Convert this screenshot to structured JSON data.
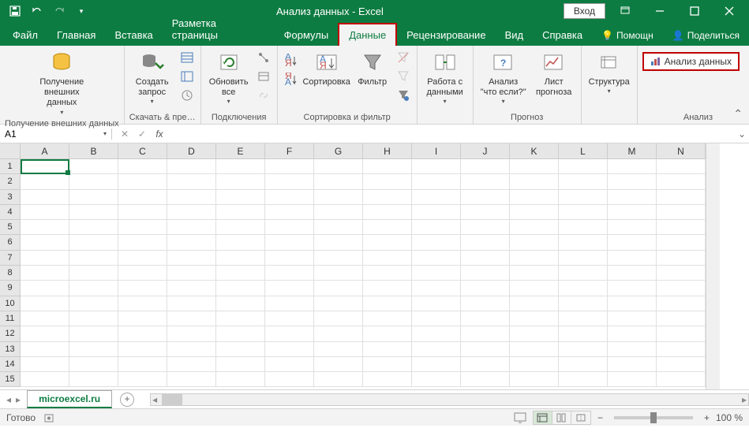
{
  "title": "Анализ данных  -  Excel",
  "login": "Вход",
  "tabs": [
    "Файл",
    "Главная",
    "Вставка",
    "Разметка страницы",
    "Формулы",
    "Данные",
    "Рецензирование",
    "Вид",
    "Справка"
  ],
  "active_tab": "Данные",
  "right_tabs": {
    "help": "Помощн",
    "share": "Поделиться"
  },
  "ribbon": {
    "ext_data": {
      "label": "Получение внешних данных",
      "btn": "Получение\nвнешних данных"
    },
    "get_transform": {
      "label": "Скачать & пре…",
      "btn": "Создать\nзапрос"
    },
    "connections": {
      "label": "Подключения",
      "btn": "Обновить\nвсе"
    },
    "sort_filter": {
      "label": "Сортировка и фильтр",
      "sort": "Сортировка",
      "filter": "Фильтр"
    },
    "data_tools": {
      "label": "",
      "btn": "Работа с\nданными"
    },
    "forecast": {
      "label": "Прогноз",
      "whatif": "Анализ \"что\nесли?\"",
      "sheet": "Лист\nпрогноза"
    },
    "outline": {
      "label": "",
      "btn": "Структура"
    },
    "analysis": {
      "label": "Анализ",
      "btn": "Анализ данных"
    }
  },
  "namebox": "A1",
  "columns": [
    "A",
    "B",
    "C",
    "D",
    "E",
    "F",
    "G",
    "H",
    "I",
    "J",
    "K",
    "L",
    "M",
    "N"
  ],
  "rows": [
    "1",
    "2",
    "3",
    "4",
    "5",
    "6",
    "7",
    "8",
    "9",
    "10",
    "11",
    "12",
    "13",
    "14",
    "15"
  ],
  "sheet": "microexcel.ru",
  "status": "Готово",
  "zoom": "100 %"
}
